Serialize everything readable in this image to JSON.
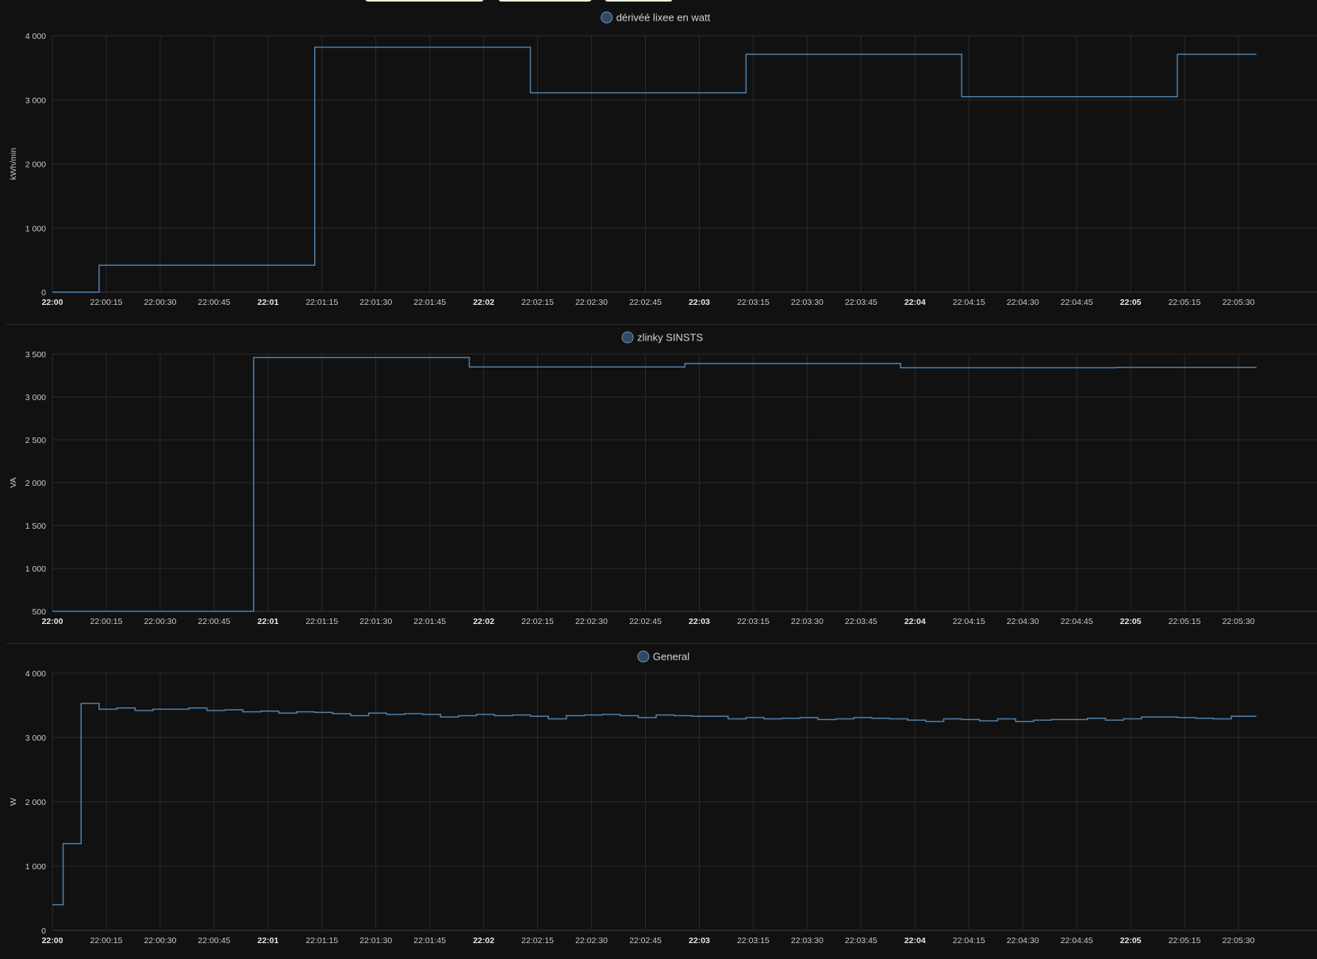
{
  "chart_data": [
    {
      "type": "line",
      "step": true,
      "legend": "dérivéé lixee en watt",
      "legend_color": "#2e4a66",
      "ylabel": "kWh/min",
      "ylim": [
        0,
        4000
      ],
      "yticks": [
        0,
        1000,
        2000,
        3000,
        4000
      ],
      "ytick_labels": [
        "0",
        "1 000",
        "2 000",
        "3 000",
        "4 000"
      ],
      "xlim": [
        0,
        335
      ],
      "xticks": [
        0,
        15,
        30,
        45,
        60,
        75,
        90,
        105,
        120,
        135,
        150,
        165,
        180,
        195,
        210,
        225,
        240,
        255,
        270,
        285,
        300,
        315,
        330
      ],
      "xtick_labels": [
        "22:00",
        "22:00:15",
        "22:00:30",
        "22:00:45",
        "22:01",
        "22:01:15",
        "22:01:30",
        "22:01:45",
        "22:02",
        "22:02:15",
        "22:02:30",
        "22:02:45",
        "22:03",
        "22:03:15",
        "22:03:30",
        "22:03:45",
        "22:04",
        "22:04:15",
        "22:04:30",
        "22:04:45",
        "22:05",
        "22:05:15",
        "22:05:30"
      ],
      "grid": true,
      "series": [
        {
          "color": "#4f80aa",
          "x": [
            0,
            13,
            73,
            133,
            193,
            253,
            313,
            335
          ],
          "y": [
            0,
            420,
            3820,
            3110,
            3710,
            3050,
            3710,
            3710
          ]
        }
      ]
    },
    {
      "type": "line",
      "step": true,
      "legend": "zlinky SINSTS",
      "legend_color": "#2e4a66",
      "ylabel": "VA",
      "ylim": [
        500,
        3500
      ],
      "yticks": [
        500,
        1000,
        1500,
        2000,
        2500,
        3000,
        3500
      ],
      "ytick_labels": [
        "500",
        "1 000",
        "1 500",
        "2 000",
        "2 500",
        "3 000",
        "3 500"
      ],
      "xlim": [
        0,
        335
      ],
      "xticks": [
        0,
        15,
        30,
        45,
        60,
        75,
        90,
        105,
        120,
        135,
        150,
        165,
        180,
        195,
        210,
        225,
        240,
        255,
        270,
        285,
        300,
        315,
        330
      ],
      "xtick_labels": [
        "22:00",
        "22:00:15",
        "22:00:30",
        "22:00:45",
        "22:01",
        "22:01:15",
        "22:01:30",
        "22:01:45",
        "22:02",
        "22:02:15",
        "22:02:30",
        "22:02:45",
        "22:03",
        "22:03:15",
        "22:03:30",
        "22:03:45",
        "22:04",
        "22:04:15",
        "22:04:30",
        "22:04:45",
        "22:05",
        "22:05:15",
        "22:05:30"
      ],
      "grid": true,
      "series": [
        {
          "color": "#4f80aa",
          "x": [
            0,
            56,
            116,
            176,
            236,
            296,
            335
          ],
          "y": [
            500,
            3460,
            3350,
            3390,
            3340,
            3345,
            3345
          ]
        }
      ]
    },
    {
      "type": "line",
      "step": true,
      "legend": "General",
      "legend_color": "#2e4a66",
      "ylabel": "W",
      "ylim": [
        0,
        4000
      ],
      "yticks": [
        0,
        1000,
        2000,
        3000,
        4000
      ],
      "ytick_labels": [
        "0",
        "1 000",
        "2 000",
        "3 000",
        "4 000"
      ],
      "xlim": [
        0,
        335
      ],
      "xticks": [
        0,
        15,
        30,
        45,
        60,
        75,
        90,
        105,
        120,
        135,
        150,
        165,
        180,
        195,
        210,
        225,
        240,
        255,
        270,
        285,
        300,
        315,
        330
      ],
      "xtick_labels": [
        "22:00",
        "22:00:15",
        "22:00:30",
        "22:00:45",
        "22:01",
        "22:01:15",
        "22:01:30",
        "22:01:45",
        "22:02",
        "22:02:15",
        "22:02:30",
        "22:02:45",
        "22:03",
        "22:03:15",
        "22:03:30",
        "22:03:45",
        "22:04",
        "22:04:15",
        "22:04:30",
        "22:04:45",
        "22:05",
        "22:05:15",
        "22:05:30"
      ],
      "grid": true,
      "series": [
        {
          "color": "#4f80aa",
          "x": [
            0,
            3,
            8,
            13,
            18,
            23,
            28,
            33,
            38,
            43,
            48,
            53,
            58,
            63,
            68,
            73,
            78,
            83,
            88,
            93,
            98,
            103,
            108,
            113,
            118,
            123,
            128,
            133,
            138,
            143,
            148,
            153,
            158,
            163,
            168,
            173,
            178,
            183,
            188,
            193,
            198,
            203,
            208,
            213,
            218,
            223,
            228,
            233,
            238,
            243,
            248,
            253,
            258,
            263,
            268,
            273,
            278,
            283,
            288,
            293,
            298,
            303,
            308,
            313,
            318,
            323,
            328,
            332,
            335
          ],
          "y": [
            400,
            1350,
            3530,
            3440,
            3460,
            3420,
            3440,
            3440,
            3460,
            3420,
            3430,
            3400,
            3410,
            3380,
            3400,
            3390,
            3370,
            3340,
            3380,
            3360,
            3370,
            3360,
            3320,
            3340,
            3360,
            3340,
            3350,
            3330,
            3290,
            3340,
            3350,
            3360,
            3340,
            3310,
            3350,
            3340,
            3330,
            3330,
            3290,
            3310,
            3290,
            3300,
            3310,
            3280,
            3290,
            3310,
            3300,
            3290,
            3270,
            3250,
            3290,
            3280,
            3260,
            3290,
            3250,
            3270,
            3280,
            3280,
            3300,
            3270,
            3290,
            3320,
            3320,
            3310,
            3300,
            3290,
            3330,
            3330,
            3330
          ]
        }
      ]
    }
  ]
}
